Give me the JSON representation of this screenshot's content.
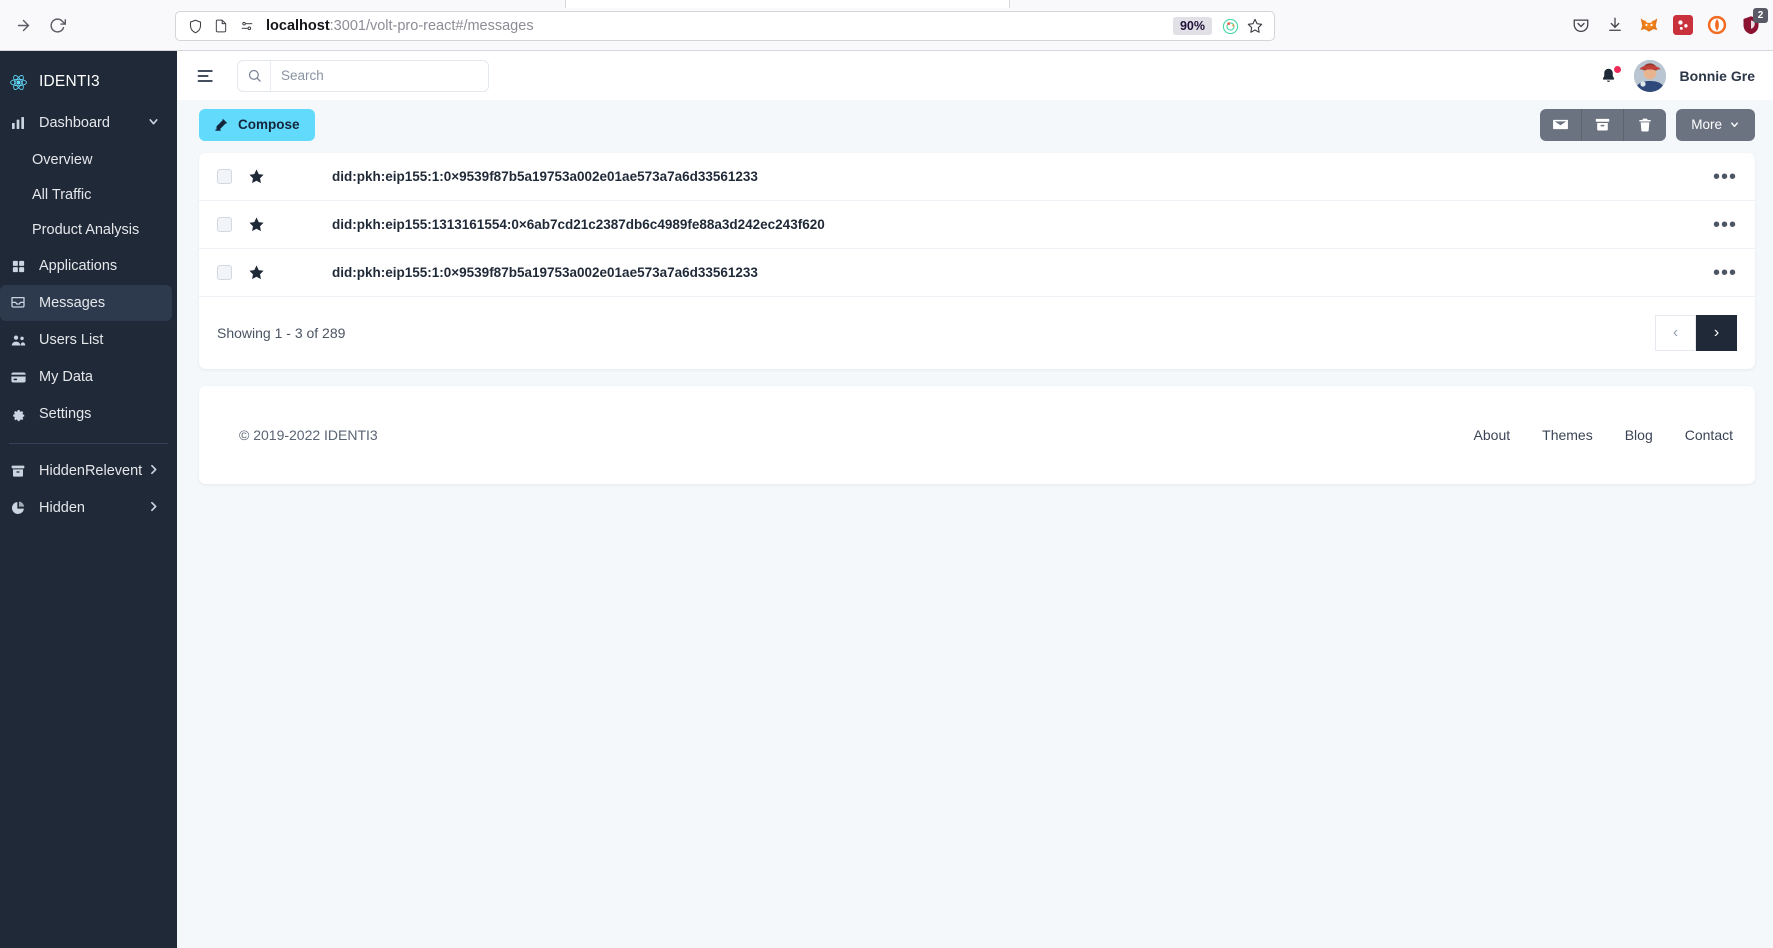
{
  "browser": {
    "url_host": "localhost",
    "url_rest": ":3001/volt-pro-react#/messages",
    "zoom_level": "90%",
    "extension_badge": "2",
    "icons": {
      "forward": "forward-arrow-icon",
      "reload": "reload-icon",
      "shield": "shield-icon",
      "page": "page-info-icon",
      "permissions": "permissions-icon",
      "tracker": "tracker-protection-icon",
      "bookmark": "bookmark-star-icon",
      "pocket": "pocket-icon",
      "downloads": "downloads-icon",
      "metamask": "metamask-extension-icon",
      "ext_red": "red-extension-icon",
      "ext_orange": "orange-extension-icon",
      "ext_shield": "shield-extension-icon"
    }
  },
  "sidebar": {
    "brand": "IDENTI3",
    "brand_icon": "react-atom-icon",
    "items": [
      {
        "label": "Dashboard",
        "icon": "bar-chart-icon",
        "chevron": "chevron-down",
        "active": false,
        "type": "group"
      },
      {
        "label": "Overview",
        "icon": "",
        "chevron": "",
        "active": false,
        "type": "sub"
      },
      {
        "label": "All Traffic",
        "icon": "",
        "chevron": "",
        "active": false,
        "type": "sub"
      },
      {
        "label": "Product Analysis",
        "icon": "",
        "chevron": "",
        "active": false,
        "type": "sub"
      },
      {
        "label": "Applications",
        "icon": "grid-icon",
        "chevron": "",
        "active": false,
        "type": "link"
      },
      {
        "label": "Messages",
        "icon": "inbox-icon",
        "chevron": "",
        "active": true,
        "type": "link"
      },
      {
        "label": "Users List",
        "icon": "users-icon",
        "chevron": "",
        "active": false,
        "type": "link"
      },
      {
        "label": "My Data",
        "icon": "card-icon",
        "chevron": "",
        "active": false,
        "type": "link"
      },
      {
        "label": "Settings",
        "icon": "gear-icon",
        "chevron": "",
        "active": false,
        "type": "link"
      }
    ],
    "bottom_items": [
      {
        "label": "HiddenRelevent",
        "icon": "archive-box-icon",
        "chevron": "chevron-right"
      },
      {
        "label": "Hidden",
        "icon": "pie-chart-icon",
        "chevron": "chevron-right"
      }
    ]
  },
  "topbar": {
    "hamburger_icon": "hamburger-menu-icon",
    "search_placeholder": "Search",
    "search_value": "",
    "search_icon": "search-icon",
    "bell_icon": "bell-icon",
    "has_notification": true,
    "user_name": "Bonnie Gre",
    "avatar_alt": "user-avatar"
  },
  "actions": {
    "compose_label": "Compose",
    "compose_icon": "compose-pencil-icon",
    "icon_buttons": [
      {
        "name": "mark-as-read-button",
        "icon": "envelope-icon"
      },
      {
        "name": "archive-button",
        "icon": "archive-icon"
      },
      {
        "name": "delete-button",
        "icon": "trash-icon"
      }
    ],
    "more_label": "More",
    "more_chevron": "chevron-down-icon"
  },
  "messages": {
    "rows": [
      {
        "title": "did:pkh:eip155:1:0×9539f87b5a19753a002e01ae573a7a6d33561233",
        "starred": true,
        "checked": false
      },
      {
        "title": "did:pkh:eip155:1313161554:0×6ab7cd21c2387db6c4989fe88a3d242ec243f620",
        "starred": true,
        "checked": false
      },
      {
        "title": "did:pkh:eip155:1:0×9539f87b5a19753a002e01ae573a7a6d33561233",
        "starred": true,
        "checked": false
      }
    ],
    "row_menu_icon": "ellipsis-icon",
    "showing_text": "Showing 1 - 3 of 289",
    "pager": {
      "prev": "‹",
      "next": "›"
    }
  },
  "footer": {
    "copyright": "© 2019-2022 IDENTI3",
    "links": [
      "About",
      "Themes",
      "Blog",
      "Contact"
    ]
  },
  "colors": {
    "sidebar_bg": "#1f2937",
    "accent": "#61dafb",
    "page_bg": "#f5f8fb",
    "gray_button": "#6b7280",
    "notification": "#f02a59"
  }
}
